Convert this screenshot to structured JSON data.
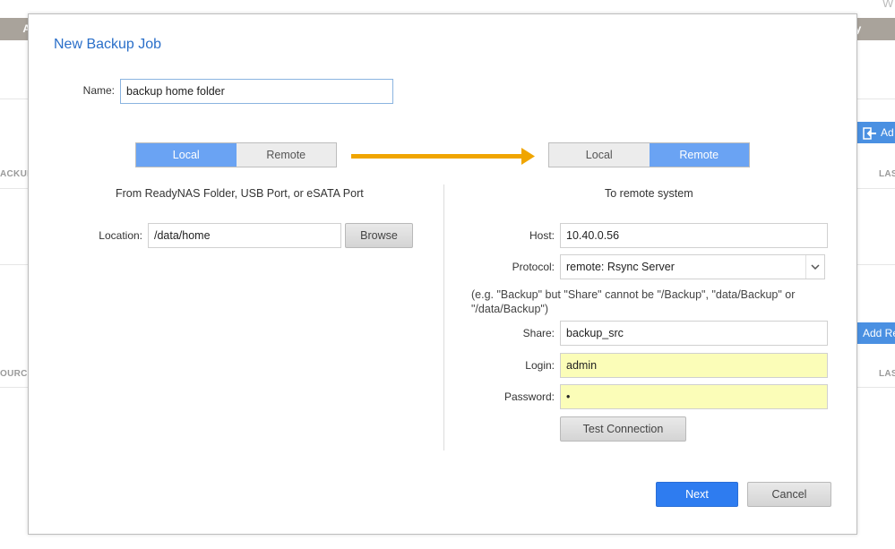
{
  "background": {
    "tab_left": "A",
    "tab_right": "nity",
    "corner_text": "W",
    "col_backup": "ACKUP",
    "col_last_1": "LAS",
    "col_source": "OURCE",
    "col_last_2": "LAS",
    "add_button_1": "Ad",
    "add_button_2": "Add Re"
  },
  "dialog": {
    "title": "New Backup Job",
    "name_label": "Name:",
    "name_value": "backup home folder",
    "source_toggle": {
      "local": "Local",
      "remote": "Remote",
      "selected": "Local"
    },
    "dest_toggle": {
      "local": "Local",
      "remote": "Remote",
      "selected": "Remote"
    },
    "arrow_color": "#f0a500",
    "source": {
      "heading": "From ReadyNAS Folder, USB Port, or eSATA Port",
      "location_label": "Location:",
      "location_value": "/data/home",
      "browse_label": "Browse"
    },
    "destination": {
      "heading": "To remote system",
      "host_label": "Host:",
      "host_value": "10.40.0.56",
      "protocol_label": "Protocol:",
      "protocol_value": "remote: Rsync Server",
      "hint": "(e.g. \"Backup\" but \"Share\" cannot be \"/Backup\", \"data/Backup\" or \"/data/Backup\")",
      "share_label": "Share:",
      "share_value": "backup_src",
      "login_label": "Login:",
      "login_value": "admin",
      "password_label": "Password:",
      "password_value": "•",
      "test_button": "Test Connection"
    },
    "next_button": "Next",
    "cancel_button": "Cancel"
  }
}
